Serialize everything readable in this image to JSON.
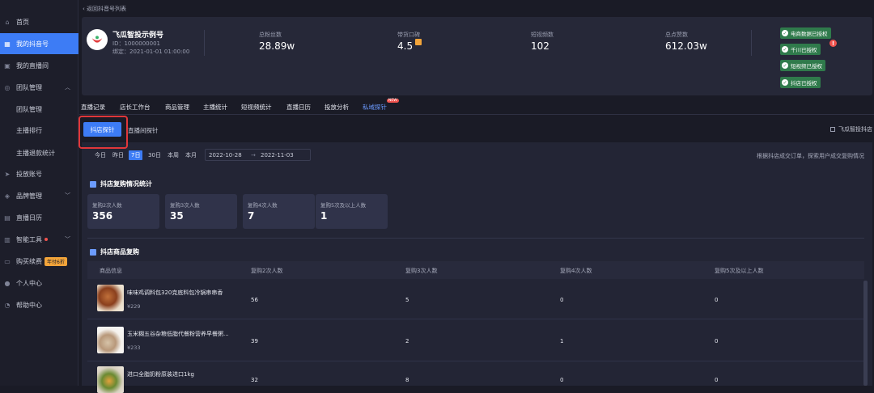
{
  "sidebar": {
    "items": [
      {
        "label": "首页",
        "icon": "home-icon"
      },
      {
        "label": "我的抖音号",
        "icon": "grid-icon",
        "active": true
      },
      {
        "label": "我的直播间",
        "icon": "live-icon"
      },
      {
        "label": "团队管理",
        "icon": "team-icon",
        "expanded": true
      },
      {
        "label": "团队管理"
      },
      {
        "label": "主播排行"
      },
      {
        "label": "主播退款统计"
      },
      {
        "label": "投放账号",
        "icon": "send-icon"
      },
      {
        "label": "品牌管理",
        "icon": "brand-icon"
      },
      {
        "label": "直播日历",
        "icon": "calendar-icon"
      },
      {
        "label": "智能工具",
        "icon": "tool-icon"
      },
      {
        "label": "购买续费",
        "icon": "cart-icon",
        "badge": "年付6折"
      },
      {
        "label": "个人中心",
        "icon": "user-icon"
      },
      {
        "label": "帮助中心",
        "icon": "help-icon"
      }
    ]
  },
  "header": {
    "back_label": "返回抖音号列表"
  },
  "profile": {
    "name": "飞瓜智投示例号",
    "id": "ID：1000000001",
    "bind": "绑定：2021-01-01 01:00:00",
    "stats": [
      {
        "label": "总粉丝数",
        "value": "28.89w"
      },
      {
        "label": "带货口碑",
        "value": "4.5"
      },
      {
        "label": "短视频数",
        "value": "102"
      },
      {
        "label": "总点赞数",
        "value": "612.03w"
      }
    ],
    "auth": [
      "电商数据已授权",
      "千川已授权",
      "短视频已授权",
      "抖店已授权"
    ],
    "warn_mark": "!"
  },
  "nav_tabs": [
    "直播记录",
    "店长工作台",
    "商品管理",
    "主播统计",
    "短视频统计",
    "直播日历",
    "投放分析",
    "私域探针"
  ],
  "new_badge": "NEW",
  "sub_tabs": [
    "抖店探针",
    "直播间探针"
  ],
  "shop_name": "飞瓜智投抖店",
  "date_filter": {
    "buttons": [
      "今日",
      "昨日",
      "7日",
      "30日",
      "本周",
      "本月"
    ],
    "active": "7日",
    "start": "2022-10-28",
    "arrow": "→",
    "end": "2022-11-03"
  },
  "note": "根据抖店成交订单，探索用户成交复购情况",
  "repurchase": {
    "title": "抖店复购情况统计",
    "cards": [
      {
        "label": "复购2次人数",
        "value": "356"
      },
      {
        "label": "复购3次人数",
        "value": "35"
      },
      {
        "label": "复购4次人数",
        "value": "7"
      },
      {
        "label": "复购5次及以上人数",
        "value": "1"
      }
    ]
  },
  "products": {
    "title": "抖店商品复购",
    "columns": [
      "商品信息",
      "复购2次人数",
      "复购3次人数",
      "复购4次人数",
      "复购5次及以上人数"
    ],
    "rows": [
      {
        "name": "味味鸡调料包320克底料包冷锅串串香",
        "price": "¥229",
        "v": [
          "56",
          "5",
          "0",
          "0"
        ]
      },
      {
        "name": "玉米糊五谷杂粮低脂代餐粉营养早餐粥...",
        "price": "¥233",
        "v": [
          "39",
          "2",
          "1",
          "0"
        ]
      },
      {
        "name": "进口全脂奶粉原装进口1kg",
        "price": "",
        "v": [
          "32",
          "8",
          "0",
          "0"
        ]
      }
    ]
  }
}
